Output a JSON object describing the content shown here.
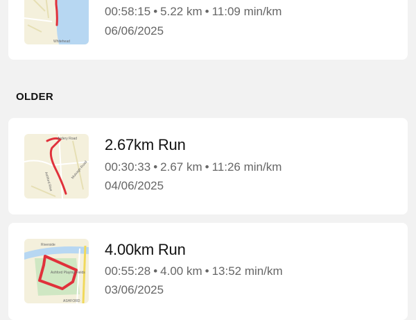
{
  "activities_top": {
    "stats": {
      "duration": "00:58:15",
      "distance": "5.22 km",
      "pace": "11:09 min/km"
    },
    "date": "06/06/2025",
    "map_label": "Whitehead"
  },
  "section_heading": "OLDER",
  "activities_older": [
    {
      "title": "2.67km Run",
      "stats": {
        "duration": "00:30:33",
        "distance": "2.67 km",
        "pace": "11:26 min/km"
      },
      "date": "04/06/2025",
      "map_labels": [
        "Ardery Road",
        "Ashford Rise",
        "Mulvagh Road"
      ]
    },
    {
      "title": "4.00km Run",
      "stats": {
        "duration": "00:55:28",
        "distance": "4.00 km",
        "pace": "13:52 min/km"
      },
      "date": "03/06/2025",
      "map_labels": [
        "Riverside",
        "Ashford Playing Fields",
        "ASHFORD"
      ]
    }
  ],
  "separator": "•",
  "colors": {
    "background": "#f2f2f2",
    "card": "#ffffff",
    "route": "#e0313b",
    "map_land": "#f4f0dc",
    "map_water": "#b7d7f2",
    "map_park": "#cfe7c3"
  }
}
